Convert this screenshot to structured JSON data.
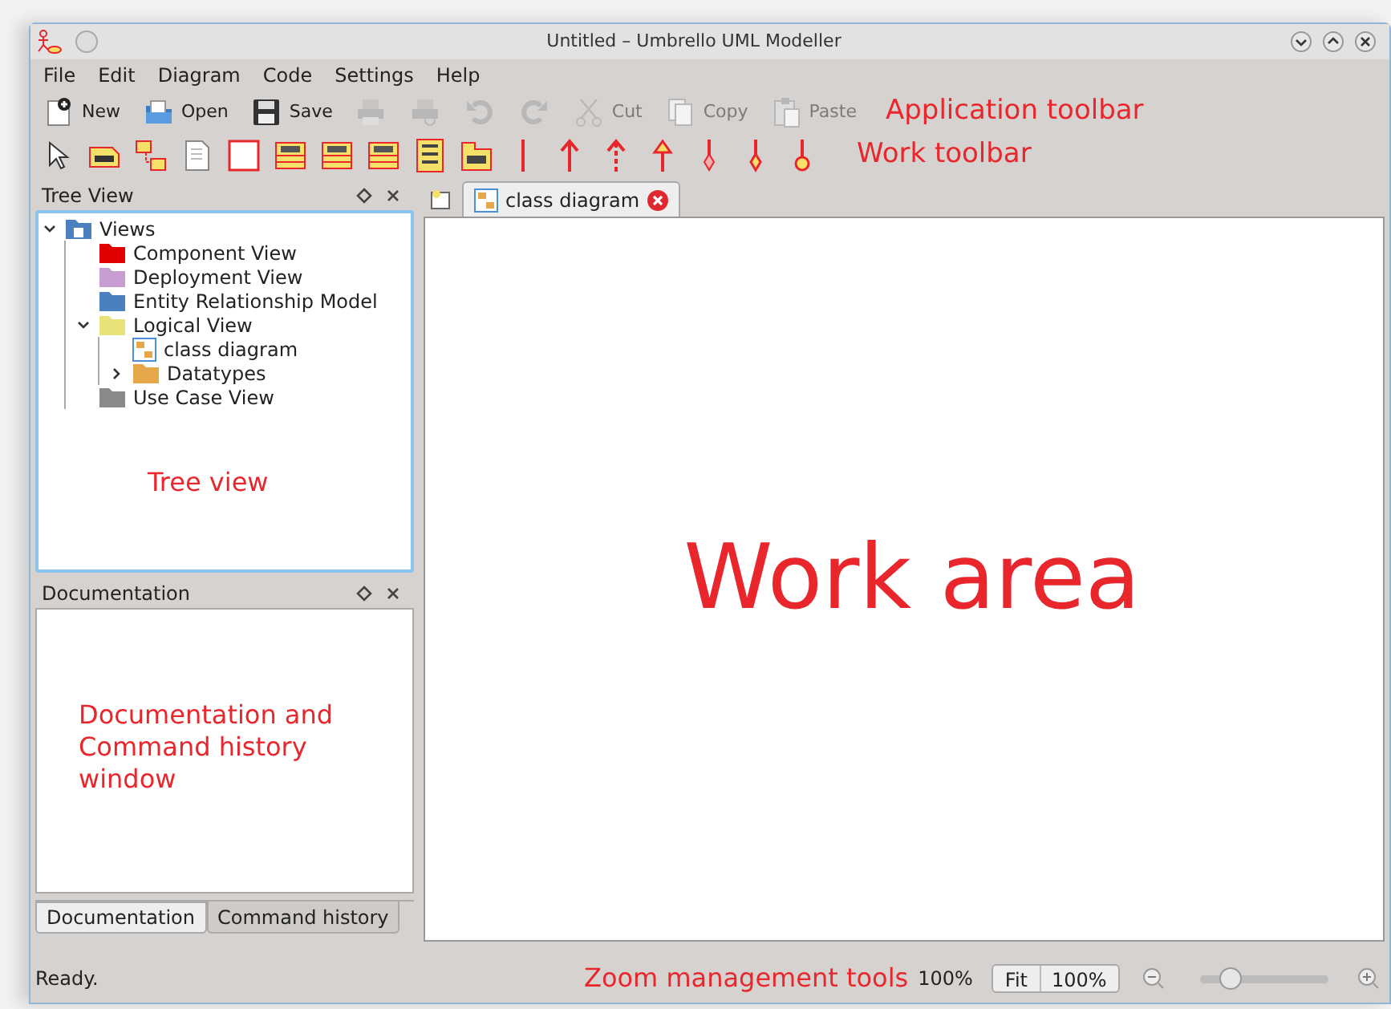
{
  "window": {
    "title": "Untitled – Umbrello UML Modeller"
  },
  "menu": [
    "File",
    "Edit",
    "Diagram",
    "Code",
    "Settings",
    "Help"
  ],
  "app_toolbar": [
    {
      "kind": "new",
      "label": "New",
      "disabled": false
    },
    {
      "kind": "open",
      "label": "Open",
      "disabled": false
    },
    {
      "kind": "save",
      "label": "Save",
      "disabled": false
    },
    {
      "kind": "print",
      "disabled": true
    },
    {
      "kind": "preview",
      "disabled": true
    },
    {
      "kind": "undo",
      "disabled": true
    },
    {
      "kind": "redo",
      "disabled": true
    },
    {
      "kind": "cut",
      "label": "Cut",
      "disabled": true
    },
    {
      "kind": "copy",
      "label": "Copy",
      "disabled": true
    },
    {
      "kind": "paste",
      "label": "Paste",
      "disabled": true
    }
  ],
  "work_toolbar": [
    {
      "kind": "pointer"
    },
    {
      "kind": "note"
    },
    {
      "kind": "anchor"
    },
    {
      "kind": "page"
    },
    {
      "kind": "box"
    },
    {
      "kind": "class"
    },
    {
      "kind": "class"
    },
    {
      "kind": "class"
    },
    {
      "kind": "list"
    },
    {
      "kind": "folder"
    },
    {
      "kind": "line"
    },
    {
      "kind": "arrow"
    },
    {
      "kind": "dashed-arrow"
    },
    {
      "kind": "triangle-arrow"
    },
    {
      "kind": "diamond"
    },
    {
      "kind": "filled-diamond"
    },
    {
      "kind": "circle-end"
    }
  ],
  "tree_view": {
    "title": "Tree View",
    "items": [
      {
        "label": "Views",
        "kind": "views",
        "expanded": true,
        "children": [
          {
            "label": "Component View",
            "kind": "folder",
            "color": "#e00000"
          },
          {
            "label": "Deployment View",
            "kind": "folder",
            "color": "#c79cd0"
          },
          {
            "label": "Entity Relationship Model",
            "kind": "folder",
            "color": "#4a7fc0"
          },
          {
            "label": "Logical View",
            "kind": "folder",
            "color": "#e8e27a",
            "expanded": true,
            "children": [
              {
                "label": "class diagram",
                "kind": "diagram"
              },
              {
                "label": "Datatypes",
                "kind": "folder",
                "color": "#e6a64a",
                "expanded": false
              }
            ]
          },
          {
            "label": "Use Case View",
            "kind": "folder",
            "color": "#8a8a8a"
          }
        ]
      }
    ]
  },
  "documentation": {
    "title": "Documentation",
    "tabs": [
      {
        "label": "Documentation",
        "selected": true
      },
      {
        "label": "Command history",
        "selected": false
      }
    ]
  },
  "diagram_tabs": [
    {
      "label": "class diagram",
      "selected": true
    }
  ],
  "annotations": {
    "app_toolbar": "Application toolbar",
    "work_toolbar": "Work toolbar",
    "tree_view": "Tree view",
    "documentation": "Documentation and Command history window",
    "work_area": "Work area",
    "zoom": "Zoom management tools"
  },
  "status_bar": {
    "message": "Ready.",
    "zoom_reading": "100%",
    "buttons": [
      "Fit",
      "100%"
    ],
    "zoom_slider": {
      "level": 0.18
    }
  }
}
